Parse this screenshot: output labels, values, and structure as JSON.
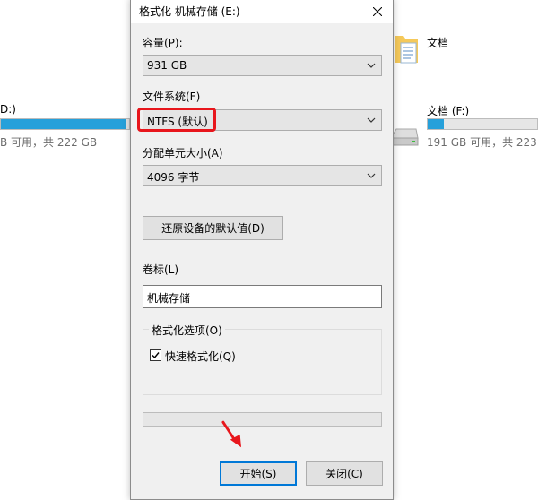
{
  "explorer": {
    "left_drive_label": "D:)",
    "left_drive_space": "B 可用，共 222 GB",
    "left_drive_used_fraction": 0.97,
    "documents_folder_label": "文档",
    "right_drive_label": "文档 (F:)",
    "right_drive_space": "191 GB 可用，共 223 G",
    "right_drive_used_fraction": 0.15
  },
  "dialog": {
    "title": "格式化 机械存储 (E:)",
    "capacity_label": "容量(P):",
    "capacity_value": "931 GB",
    "filesystem_label": "文件系统(F)",
    "filesystem_value": "NTFS (默认)",
    "allocation_label": "分配单元大小(A)",
    "allocation_value": "4096 字节",
    "restore_defaults_label": "还原设备的默认值(D)",
    "volume_label_caption": "卷标(L)",
    "volume_label_value": "机械存储",
    "format_options_title": "格式化选项(O)",
    "quick_format_label": "快速格式化(Q)",
    "quick_format_checked": true,
    "progress_fraction": 0,
    "start_button_label": "开始(S)",
    "close_button_label": "关闭(C)"
  },
  "colors": {
    "accent": "#0078d7",
    "highlight_red": "#e8161c",
    "drive_bar": "#26a0da"
  }
}
